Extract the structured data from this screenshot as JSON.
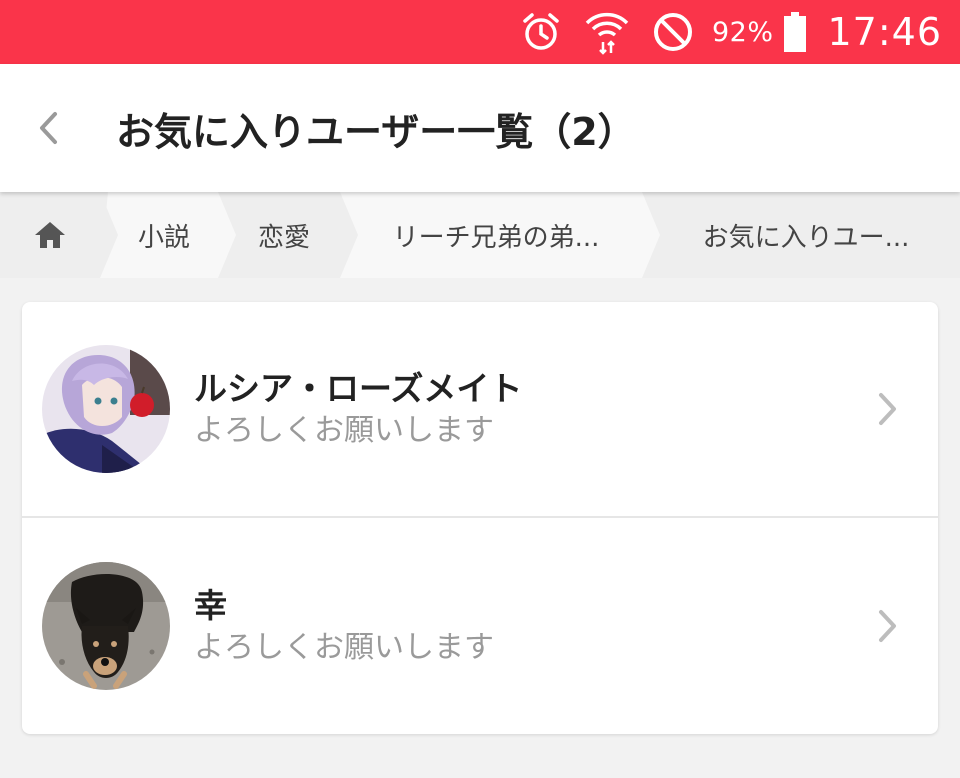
{
  "status_bar": {
    "battery_percent": "92%",
    "time": "17:46",
    "icons": [
      "alarm-icon",
      "wifi-icon",
      "do-not-disturb-icon",
      "battery-icon"
    ],
    "background_color": "#fa344a"
  },
  "header": {
    "title": "お気に入りユーザー一覧（2）",
    "back_icon": "chevron-left-icon"
  },
  "breadcrumb": {
    "home_icon": "home-icon",
    "items": [
      {
        "label": "小説"
      },
      {
        "label": "恋愛"
      },
      {
        "label": "リーチ兄弟の弟..."
      },
      {
        "label": "お気に入りユー..."
      }
    ]
  },
  "users": [
    {
      "name": "ルシア・ローズメイト",
      "bio": "よろしくお願いします",
      "avatar": "anime-character-avatar"
    },
    {
      "name": "幸",
      "bio": "よろしくお願いします",
      "avatar": "dog-photo-avatar"
    }
  ]
}
